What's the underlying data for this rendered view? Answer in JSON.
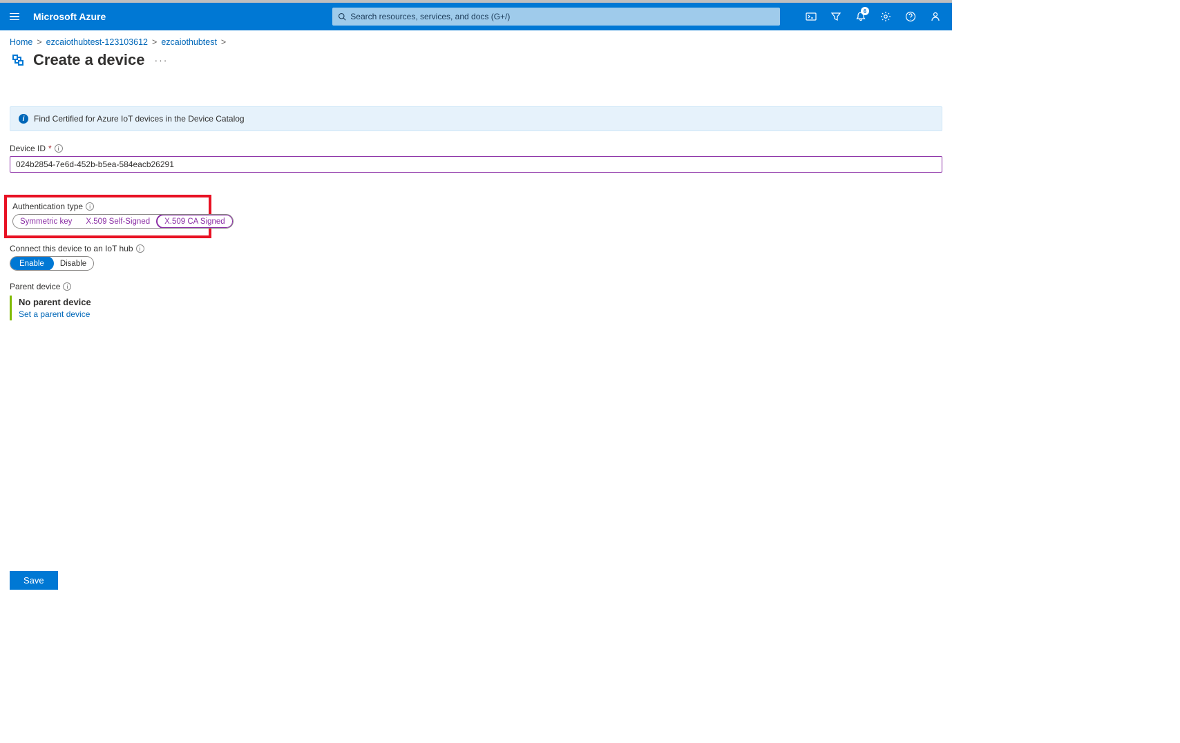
{
  "header": {
    "brand": "Microsoft Azure",
    "search_placeholder": "Search resources, services, and docs (G+/)",
    "notification_count": "6"
  },
  "breadcrumb": {
    "items": [
      "Home",
      "ezcaiothubtest-123103612",
      "ezcaiothubtest"
    ]
  },
  "page": {
    "title": "Create a device"
  },
  "banner": {
    "text": "Find Certified for Azure IoT devices in the Device Catalog"
  },
  "device_id": {
    "label": "Device ID",
    "value": "024b2854-7e6d-452b-b5ea-584eacb26291"
  },
  "auth_type": {
    "label": "Authentication type",
    "options": [
      "Symmetric key",
      "X.509 Self-Signed",
      "X.509 CA Signed"
    ],
    "selected_index": 2
  },
  "connect": {
    "label": "Connect this device to an IoT hub",
    "options": [
      "Enable",
      "Disable"
    ],
    "selected_index": 0
  },
  "parent": {
    "label": "Parent device",
    "none_text": "No parent device",
    "link_text": "Set a parent device"
  },
  "footer": {
    "save_label": "Save"
  }
}
